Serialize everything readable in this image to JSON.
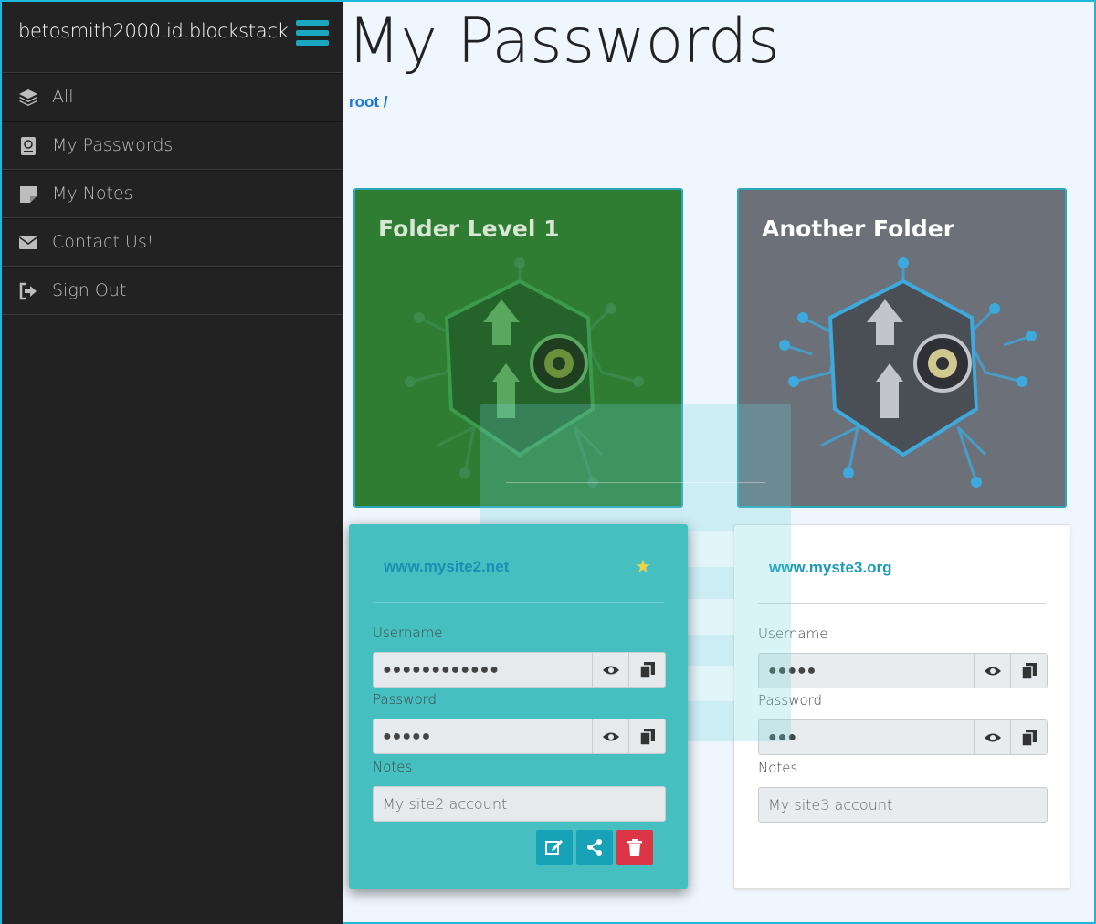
{
  "sidebar": {
    "user": "betosmith2000.id.blockstack",
    "items": [
      {
        "label": "All",
        "icon": "layers-icon"
      },
      {
        "label": "My Passwords",
        "icon": "passport-icon"
      },
      {
        "label": "My Notes",
        "icon": "sticky-note-icon"
      },
      {
        "label": "Contact Us!",
        "icon": "envelope-icon"
      },
      {
        "label": "Sign Out",
        "icon": "sign-out-icon"
      }
    ]
  },
  "main": {
    "title": "My Passwords",
    "breadcrumb": "root /"
  },
  "folders": [
    {
      "title": "Folder Level 1",
      "color": "#2e7d32"
    },
    {
      "title": "Another Folder",
      "color": "#6b7079"
    }
  ],
  "cards": [
    {
      "site": "www.mysite2.net",
      "username_label": "Username",
      "username": "●●●●●●●●●●●●",
      "password_label": "Password",
      "password": "●●●●●",
      "notes_label": "Notes",
      "notes": "My site2 account"
    },
    {
      "site": "www.myste3.org",
      "username_label": "Username",
      "username": "●●●●●",
      "password_label": "Password",
      "password": "●●●",
      "notes_label": "Notes",
      "notes": "My site3 account"
    }
  ],
  "colors": {
    "accent": "#1aa7bf",
    "danger": "#dc3545",
    "sidebar_bg": "#222222",
    "link": "#1a73d9"
  }
}
